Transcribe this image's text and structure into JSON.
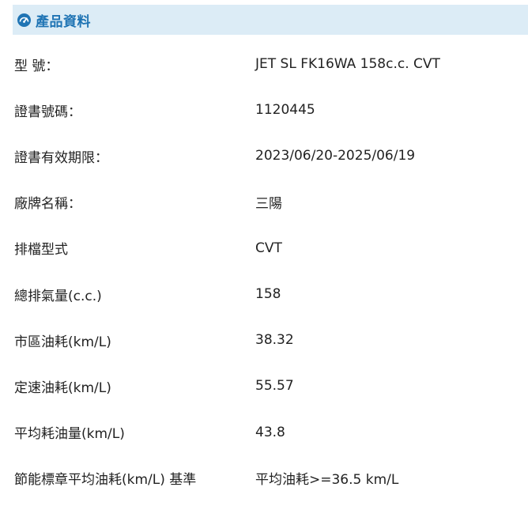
{
  "header": {
    "icon": "speedometer-icon",
    "title": "產品資料",
    "accent_color": "#1f74b4",
    "background_color": "#dcecf6"
  },
  "rows": [
    {
      "label": "型 號：",
      "value": "JET SL FK16WA 158c.c. CVT"
    },
    {
      "label": "證書號碼：",
      "value": "1120445"
    },
    {
      "label": "證書有效期限：",
      "value": "2023/06/20-2025/06/19"
    },
    {
      "label": "廠牌名稱：",
      "value": "三陽"
    },
    {
      "label": "排檔型式",
      "value": "CVT"
    },
    {
      "label": "總排氣量(c.c.)",
      "value": "158"
    },
    {
      "label": "市區油耗(km/L)",
      "value": "38.32"
    },
    {
      "label": "定速油耗(km/L)",
      "value": "55.57"
    },
    {
      "label": "平均耗油量(km/L)",
      "value": "43.8"
    },
    {
      "label": "節能標章平均油耗(km/L) 基準",
      "value": "平均油耗>=36.5 km/L"
    }
  ]
}
